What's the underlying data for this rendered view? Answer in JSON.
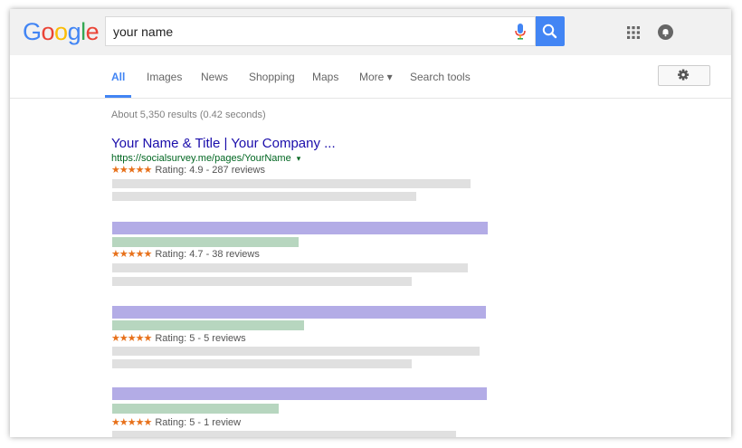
{
  "search": {
    "query": "your name"
  },
  "logo": {
    "letters": [
      "G",
      "o",
      "o",
      "g",
      "l",
      "e"
    ],
    "colors": [
      "#4285f4",
      "#ea4335",
      "#fbbc05",
      "#4285f4",
      "#34a853",
      "#ea4335"
    ]
  },
  "tabs": [
    {
      "label": "All"
    },
    {
      "label": "Images"
    },
    {
      "label": "News"
    },
    {
      "label": "Shopping"
    },
    {
      "label": "Maps"
    },
    {
      "label": "More ▾"
    },
    {
      "label": "Search tools"
    }
  ],
  "stats": "About 5,350 results (0.42 seconds)",
  "results": [
    {
      "title": "Your Name & Title | Your Company ...",
      "url": "https://socialsurvey.me/pages/YourName",
      "url_caret": "▾",
      "stars": "★★★★★",
      "rating": "Rating: 4.9 - 287 reviews"
    },
    {
      "stars": "★★★★★",
      "rating": "Rating: 4.7 - 38 reviews"
    },
    {
      "stars": "★★★★★",
      "rating": "Rating: 5 - 5 reviews"
    },
    {
      "stars": "★★★★★",
      "rating": "Rating: 5 - 1 review"
    }
  ],
  "colors": {
    "accent": "#4285f4",
    "link": "#1a0dab",
    "url": "#006621",
    "star": "#e7711b",
    "placeholder_title": "#b3ace6",
    "placeholder_url": "#b7d6bf",
    "placeholder_text": "#e0e0e0"
  },
  "icons": [
    "mic-icon",
    "search-icon",
    "apps-grid-icon",
    "notifications-icon",
    "settings-gear-icon"
  ]
}
